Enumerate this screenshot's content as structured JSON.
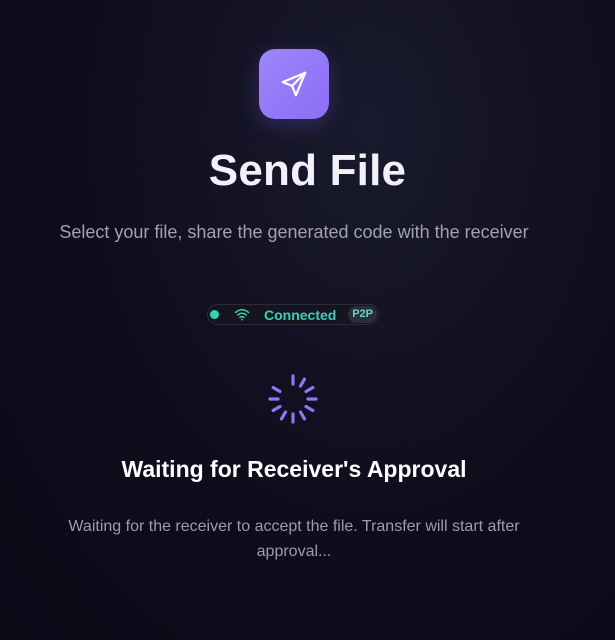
{
  "header": {
    "icon": "send-icon",
    "title": "Send File",
    "subtitle": "Select your file, share the generated code with the receiver"
  },
  "connection": {
    "icon": "wifi-icon",
    "status": "Connected",
    "mode": "P2P",
    "status_color": "#2fd3b7"
  },
  "waiting": {
    "icon": "spinner-icon",
    "heading": "Waiting for Receiver's Approval",
    "message": "Waiting for the receiver to accept the file. Transfer will start after approval..."
  },
  "colors": {
    "accent": "#8f76f7",
    "background": "#0d0d1c"
  }
}
